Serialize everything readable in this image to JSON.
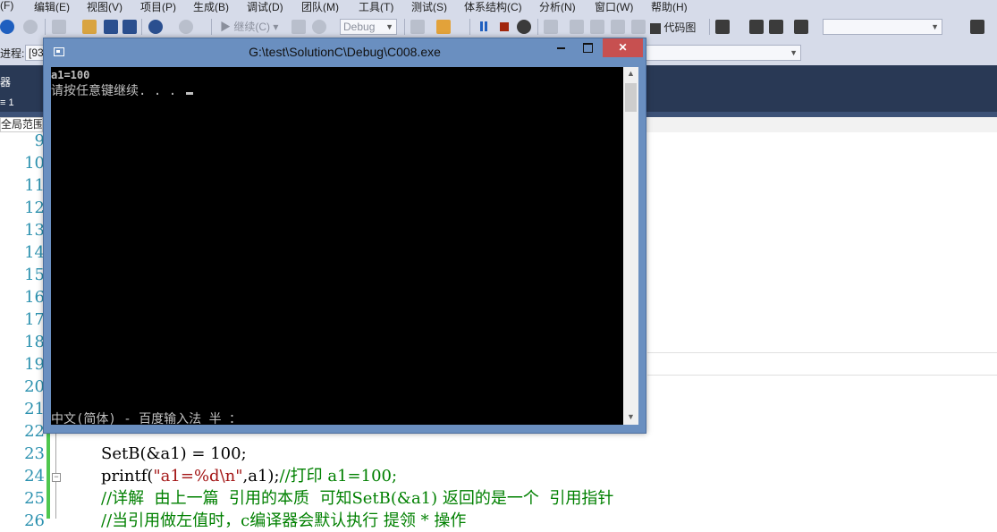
{
  "menu": [
    "(F)",
    "编辑(E)",
    "视图(V)",
    "项目(P)",
    "生成(B)",
    "调试(D)",
    "团队(M)",
    "工具(T)",
    "测试(S)",
    "体系结构(C)",
    "分析(N)",
    "窗口(W)",
    "帮助(H)"
  ],
  "toolbar": {
    "continue_label": "继续(C)",
    "config_value": "Debug",
    "codemap_label": "代码图"
  },
  "debugbar": {
    "process_label": "进程:",
    "process_value": "[93"
  },
  "left_panel": {
    "label_a": "器",
    "label_b": "≡ 1",
    "scope_label": "全局范围"
  },
  "console": {
    "title": "G:\\test\\SolutionC\\Debug\\C008.exe",
    "output_line1": "a1=100",
    "output_line2": "请按任意键继续. . . ",
    "ime_status": "中文(简体) - 百度输入法 半 ："
  },
  "editor": {
    "line_numbers": [
      "9",
      "10",
      "11",
      "12",
      "13",
      "14",
      "15",
      "16",
      "17",
      "18",
      "19",
      "20",
      "21",
      "22",
      "23",
      "24",
      "25",
      "26"
    ],
    "code_line23": "SetB(&a1) = 100;",
    "code_line24_a": "printf(",
    "code_line24_str": "\"a1=%d\\n\"",
    "code_line24_b": ",a1);",
    "code_line24_cmt": "//打印 a1=100;",
    "code_line25_cmt": "//详解  由上一篇  引用的本质  可知SetB(&a1) 返回的是一个  引用指针",
    "code_line26_cmt": "//当引用做左值时，c编译器会默认执行 提领 * 操作"
  },
  "colors": {
    "ide_chrome": "#d6dbe9",
    "console_frame": "#6a8fc0",
    "close_button": "#c75050",
    "line_number": "#2b91af",
    "comment": "#008000",
    "string": "#a31515"
  }
}
